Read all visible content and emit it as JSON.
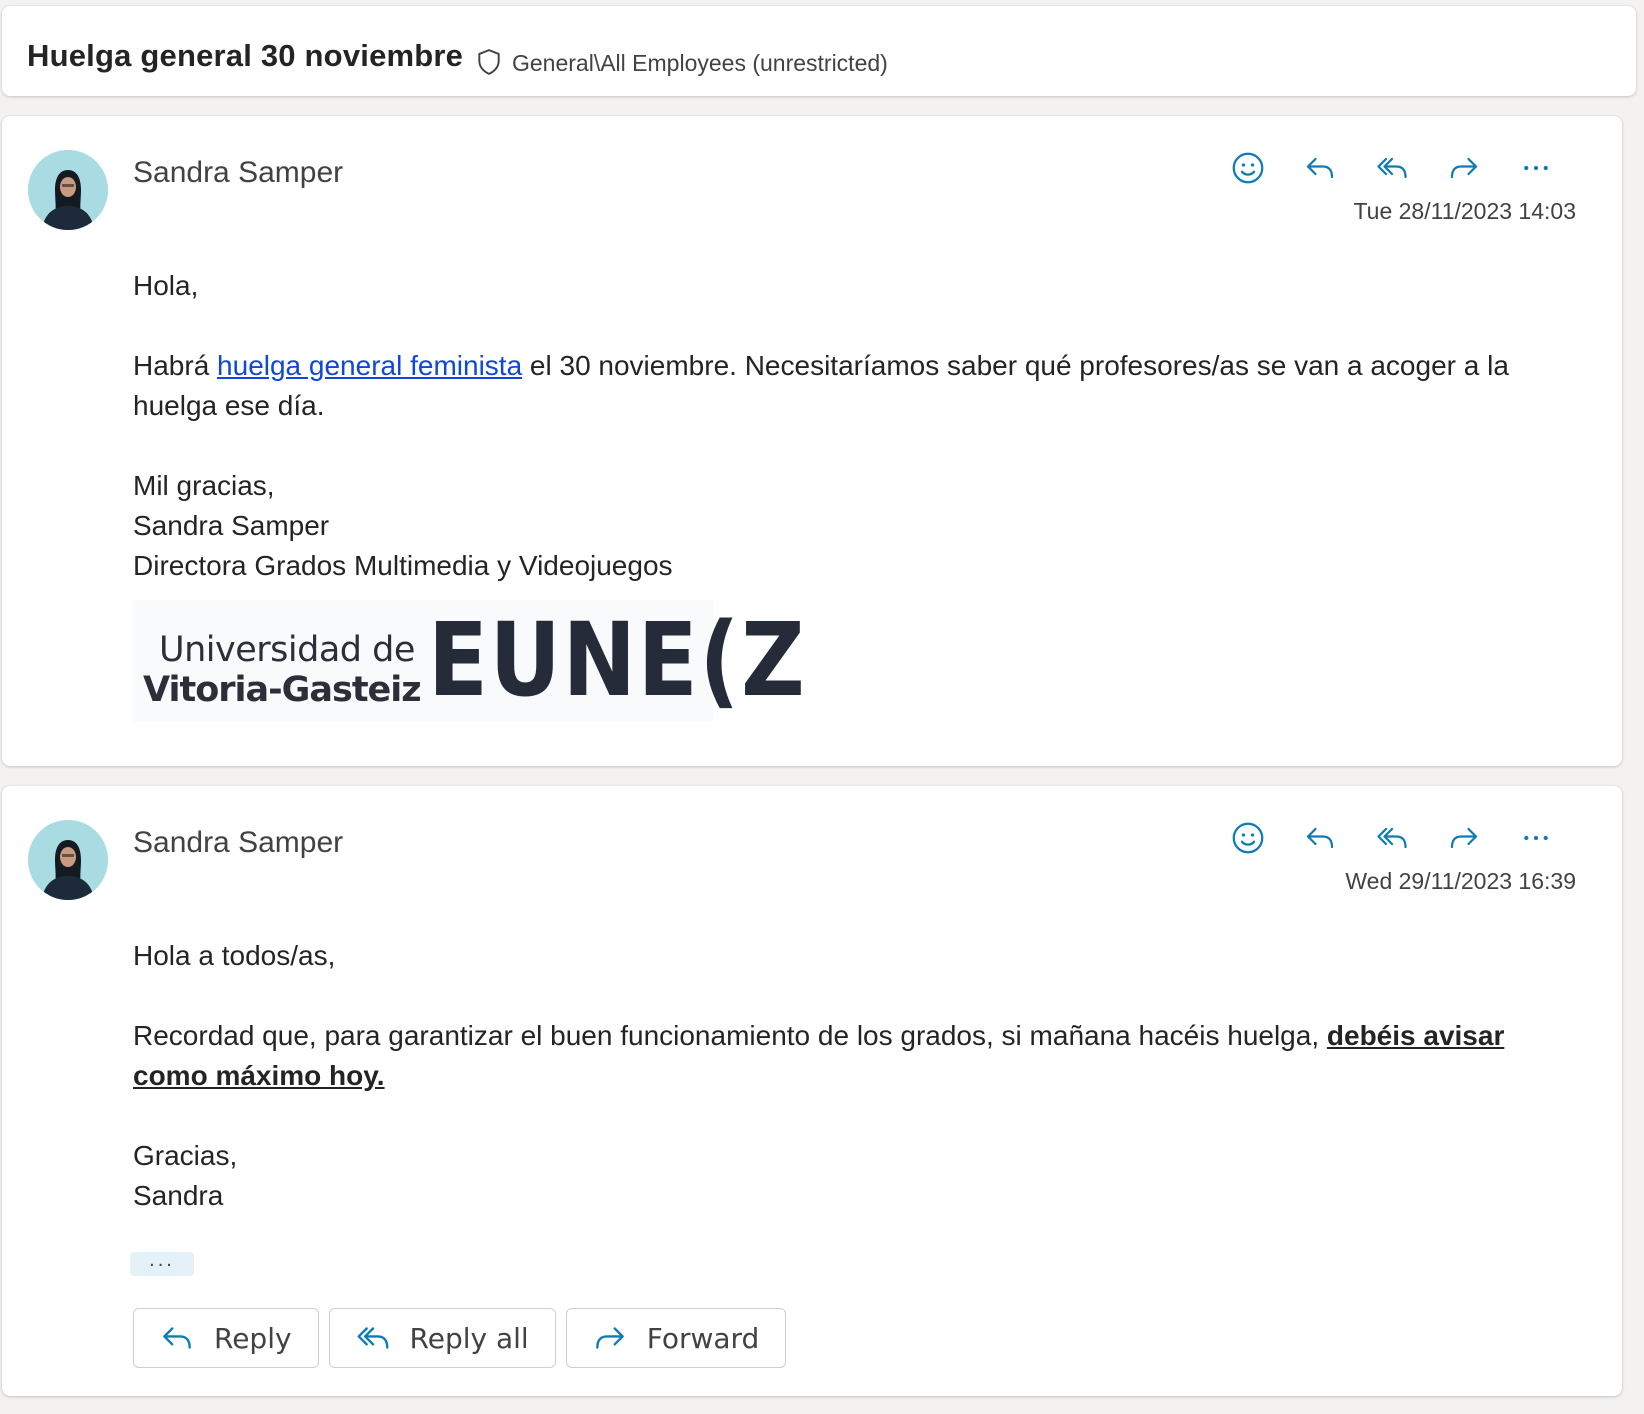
{
  "subject": {
    "title": "Huelga general 30 noviembre",
    "label": "General\\All Employees (unrestricted)",
    "label_icon": "shield-icon"
  },
  "colors": {
    "accent": "#0f7bb3",
    "link": "#0f47d6"
  },
  "messages": [
    {
      "sender": "Sandra Samper",
      "date": "Tue 28/11/2023 14:03",
      "greeting": "Hola,",
      "para_before_link": "Habrá ",
      "link_text": "huelga general feminista",
      "para_after_link": " el 30 noviembre. Necesitaríamos saber qué profesores/as se van a acoger a la huelga ese día.",
      "closing": "Mil gracias,",
      "sig_name": "Sandra Samper",
      "sig_title": "Directora Grados Multimedia y Videojuegos",
      "logo_line1": "Universidad de",
      "logo_line2": "Vitoria-Gasteiz",
      "logo_mark": "EUNE(Z"
    },
    {
      "sender": "Sandra Samper",
      "date": "Wed 29/11/2023 16:39",
      "greeting": "Hola a todos/as,",
      "para_text": "Recordad que, para garantizar el buen funcionamiento de los grados, si mañana hacéis huelga, ",
      "para_emphasis": "debéis avisar como máximo hoy.",
      "closing": "Gracias,",
      "sig_name": "Sandra",
      "more_label": "...",
      "buttons": {
        "reply": "Reply",
        "reply_all": "Reply all",
        "forward": "Forward"
      }
    }
  ]
}
